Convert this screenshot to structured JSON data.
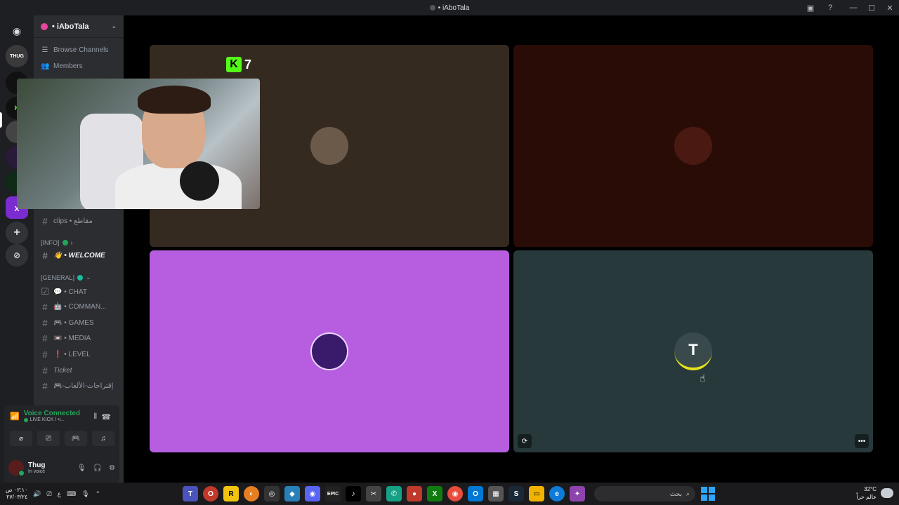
{
  "window": {
    "title": "• iAboTala"
  },
  "guild": {
    "name": "• iAboTala"
  },
  "sidebar": {
    "nav": [
      {
        "label": "Browse Channels",
        "icon": "browse-icon"
      },
      {
        "label": "Members",
        "icon": "members-icon"
      }
    ],
    "channels_top": [
      {
        "label": "clips • مقاطع"
      }
    ],
    "cat_info": "[INFO]",
    "welcome": "👋 • WELCOME",
    "cat_general": "[GENERAL]",
    "channels": [
      {
        "label": "💬 • CHAT"
      },
      {
        "label": "🤖 • COMMAN..."
      },
      {
        "label": "🎮 • GAMES"
      },
      {
        "label": "📼 • MEDIA"
      },
      {
        "label": "❗ • LEVEL"
      },
      {
        "label": "Ticket"
      },
      {
        "label": "🎮-إقتراحات-الألعاب"
      }
    ]
  },
  "rail": {
    "top_label": "THUG",
    "x_label": "X"
  },
  "voice": {
    "status": "Voice Connected",
    "channel": "LIVE KICK / •i...",
    "buttons": [
      "video-off",
      "screen-share",
      "activity",
      "soundboard"
    ]
  },
  "user": {
    "name": "Thug",
    "status": "In voice"
  },
  "overlay": {
    "kick_count": "7",
    "kick_logo": "K"
  },
  "tiles": [
    {
      "bg": "#352a20",
      "avatar": ""
    },
    {
      "bg": "#2a0c07",
      "avatar": ""
    },
    {
      "bg": "#b65de0",
      "avatar": ""
    },
    {
      "bg": "#27393b",
      "avatar": "T"
    }
  ],
  "taskbar": {
    "time": "٠٢:١٠ ص",
    "date": "٢٧/٠٣/٢٤",
    "lang": "ع",
    "search_placeholder": "بحث",
    "temp": "32°C",
    "weather_text": "عالم حراً"
  }
}
